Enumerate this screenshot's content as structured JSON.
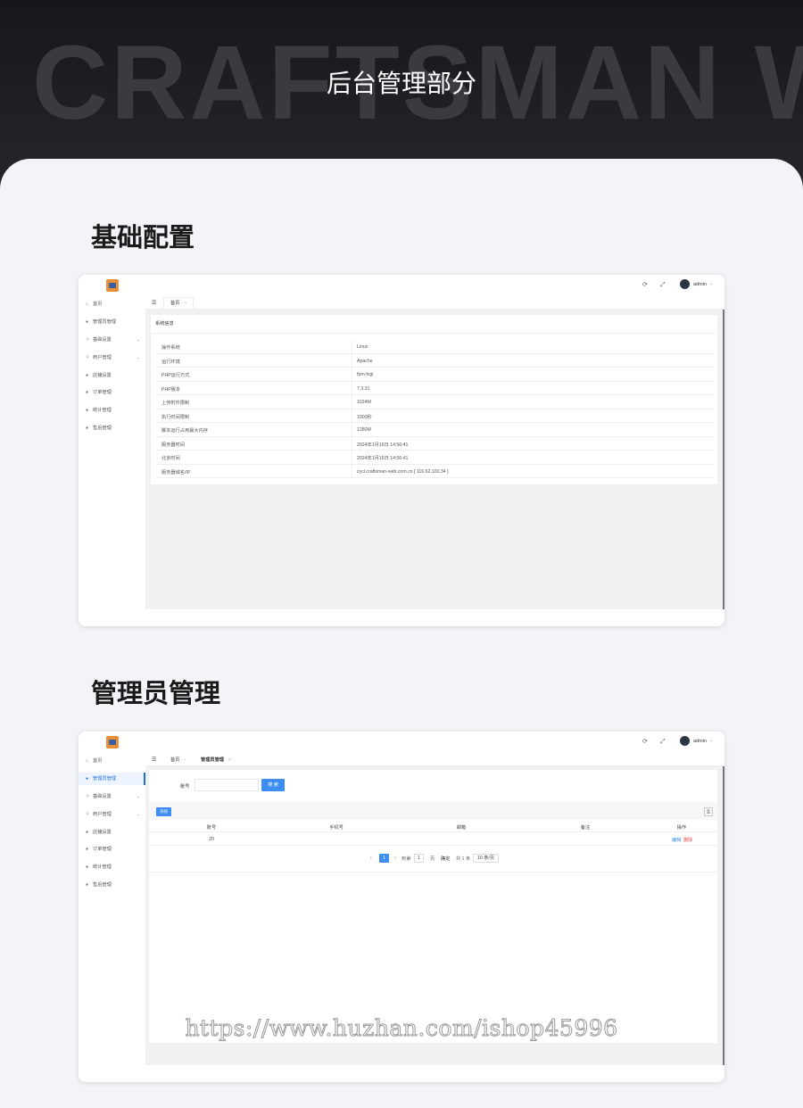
{
  "banner": {
    "bg_text": "CRAFTSMAN WEB",
    "title": "后台管理部分"
  },
  "section1": {
    "title": "基础配置"
  },
  "section2": {
    "title": "管理员管理"
  },
  "topbar": {
    "user": "admin"
  },
  "sidebar_items": [
    "首页",
    "管理员管理",
    "基础设置",
    "商户管理",
    "店铺设置",
    "订单管理",
    "统计管理",
    "售后管理"
  ],
  "screen1": {
    "tabs": [
      "首页"
    ],
    "info_title": "系统信息",
    "rows": [
      {
        "k": "操作系统",
        "v": "Linux"
      },
      {
        "k": "运行环境",
        "v": "Apache"
      },
      {
        "k": "PHP运行方式",
        "v": "fpm-fcgi"
      },
      {
        "k": "PHP版本",
        "v": "7.3.31"
      },
      {
        "k": "上传附件限制",
        "v": "1024M"
      },
      {
        "k": "执行时间限制",
        "v": "1000秒"
      },
      {
        "k": "脚本运行占用最大内存",
        "v": "1280M"
      },
      {
        "k": "服务器时间",
        "v": "2024年1月16日 14:56:41"
      },
      {
        "k": "北京时间",
        "v": "2024年1月16日 14:56:41"
      },
      {
        "k": "服务器域名/IP",
        "v": "zycl.craftsman-web.com.cn [ 116.62.100.34 ]"
      }
    ]
  },
  "screen2": {
    "tabs": [
      "首页",
      "管理员管理"
    ],
    "search_label": "账号",
    "search_button": "搜 索",
    "add_button": "添加",
    "columns": [
      "账号",
      "手机号",
      "邮箱",
      "备注",
      "操作"
    ],
    "row": {
      "account": "20",
      "edit": "编辑",
      "delete": "删除"
    },
    "pager": {
      "current": "1",
      "goto_label": "到第",
      "page_input": "1",
      "page_unit": "页",
      "confirm": "确定",
      "total": "共 1 条",
      "page_size": "10 条/页"
    }
  },
  "watermark": "https://www.huzhan.com/ishop45996"
}
